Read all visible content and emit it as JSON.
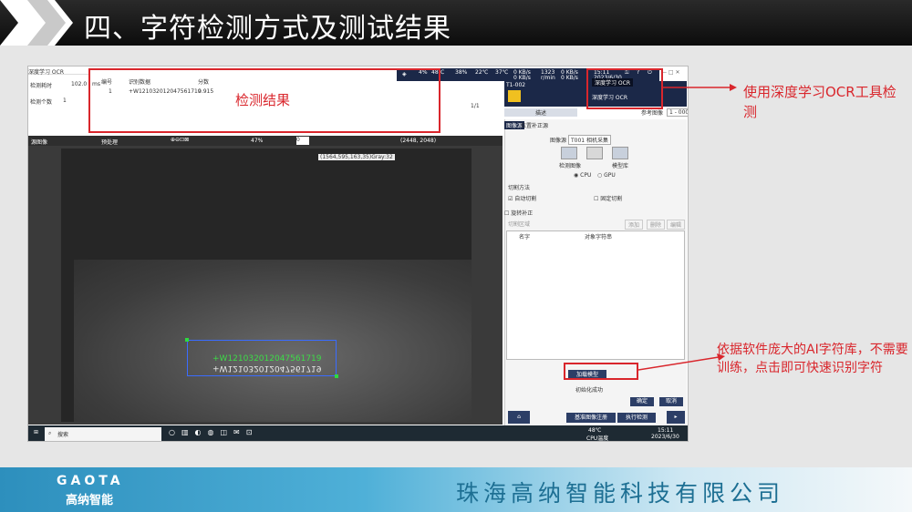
{
  "slide": {
    "title": "四、字符检测方式及测试结果",
    "company": "珠海高纳智能科技有限公司",
    "brand_logo": "GAOTA",
    "brand_cn": "高纳智能"
  },
  "callouts": {
    "result_label": "检测结果",
    "ocr_note": "使用深度学习OCR工具检测",
    "ai_note": "依据软件庞大的AI字符库，不需要训练，点击即可快速识别字符"
  },
  "app": {
    "window_title": "深度学习 OCR",
    "left_info": {
      "rows": [
        {
          "label": "检测耗时",
          "value": "102.0",
          "unit": "ms"
        },
        {
          "label": "检测个数",
          "value": "1"
        }
      ]
    },
    "results": {
      "headers": [
        "编号",
        "识别数据",
        "分数"
      ],
      "row": [
        "1",
        "+W121032012047561719",
        "0.915"
      ],
      "pager": "1/1"
    },
    "stats": [
      "4%",
      "48℃",
      "38%",
      "22℃",
      "37℃",
      "0 KB/s",
      "0 KB/s",
      "1323",
      "r/min",
      "0 KB/s",
      "0 KB/s"
    ],
    "clock": {
      "time": "15:11",
      "date": "2023/6/30"
    },
    "tool_id": "T1-002",
    "dropdown_selected": "深度学习 OCR",
    "dropdown_option": "深度学习 OCR",
    "toolbar": {
      "mode": "描述",
      "ref_label": "参考图像",
      "ref_value": "1 - 000"
    },
    "image_toolbar": {
      "source": "源图像",
      "process": "预处理",
      "zoom": "47%",
      "value": "0",
      "resolution": "(2448, 2048)",
      "tooltip": "(1564,595,163,35)Gray:32"
    },
    "ocr_text": {
      "line1": "+W121032012047561719",
      "line2": "+W121032012047561719"
    },
    "panel": {
      "tab1": "图像源",
      "tab2": "位置补正源",
      "source_label": "图像源",
      "source_value": "T001 相机采集",
      "icon_labels": [
        "检测图像",
        "",
        "模型库"
      ],
      "cpu": "CPU",
      "gpu": "GPU",
      "section": "切割方法",
      "opt1": "自动切割",
      "opt2": "固定切割",
      "rotate": "旋转补正",
      "cut_area": "切割区域",
      "btns": [
        "添加",
        "删除",
        "编辑"
      ],
      "table_headers": [
        "名字",
        "对象字符串"
      ],
      "load_model": "加载模型",
      "init_status": "初始化成功",
      "ok": "确定",
      "cancel": "取消",
      "bottom_btns": [
        "基准图像注册",
        "执行检测"
      ]
    },
    "taskbar": {
      "search": "搜索",
      "temp": "48℃",
      "temp_label": "CPU温度",
      "time": "15:11",
      "date": "2023/6/30"
    }
  },
  "colors": {
    "accent_red": "#d9262c",
    "dark_bar": "#1b2848",
    "footer_blue": "#2d8fbd"
  }
}
